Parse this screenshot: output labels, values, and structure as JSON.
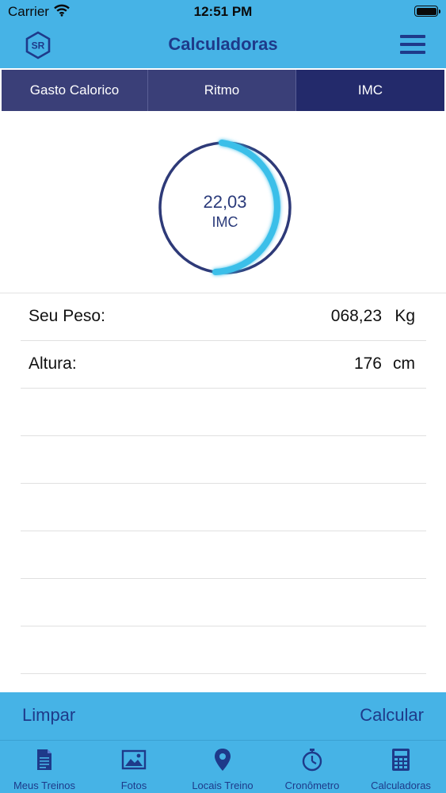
{
  "status_bar": {
    "carrier": "Carrier",
    "time": "12:51 PM"
  },
  "nav": {
    "title": "Calculadoras",
    "logo_text": "SR"
  },
  "segments": [
    {
      "label": "Gasto Calorico",
      "active": false
    },
    {
      "label": "Ritmo",
      "active": false
    },
    {
      "label": "IMC",
      "active": true
    }
  ],
  "gauge": {
    "value": "22,03",
    "label": "IMC"
  },
  "fields": [
    {
      "label": "Seu Peso:",
      "value": "068,23",
      "unit": "Kg"
    },
    {
      "label": "Altura:",
      "value": "176",
      "unit": "cm"
    }
  ],
  "actions": {
    "clear": "Limpar",
    "calculate": "Calcular"
  },
  "tabs": [
    {
      "label": "Meus Treinos",
      "icon": "document-icon"
    },
    {
      "label": "Fotos",
      "icon": "photo-icon"
    },
    {
      "label": "Locais Treino",
      "icon": "map-pin-icon"
    },
    {
      "label": "Cronômetro",
      "icon": "stopwatch-icon"
    },
    {
      "label": "Calculadoras",
      "icon": "calculator-icon"
    }
  ],
  "colors": {
    "bar": "#46b3e6",
    "accent_dark": "#1e3a8a",
    "segment": "#3a3f78",
    "gauge_track": "#2e3a78",
    "gauge_fill": "#3bbfe9"
  }
}
